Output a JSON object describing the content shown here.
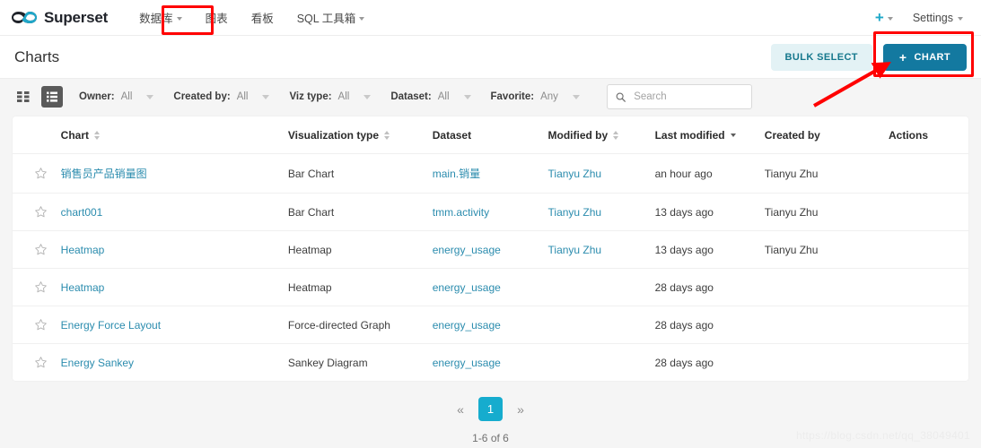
{
  "navbar": {
    "brand": "Superset",
    "items": [
      {
        "label": "数据库",
        "has_caret": true
      },
      {
        "label": "图表",
        "has_caret": false
      },
      {
        "label": "看板",
        "has_caret": false
      },
      {
        "label": "SQL 工具箱",
        "has_caret": true
      }
    ],
    "plus_label": "+",
    "settings_label": "Settings"
  },
  "header": {
    "title": "Charts",
    "bulk_select_label": "BULK SELECT",
    "new_chart_label": "CHART",
    "new_chart_plus": "+"
  },
  "filters": {
    "card_view_icon": "grid-icon",
    "list_view_icon": "list-icon",
    "items": [
      {
        "label": "Owner:",
        "value": "All"
      },
      {
        "label": "Created by:",
        "value": "All"
      },
      {
        "label": "Viz type:",
        "value": "All"
      },
      {
        "label": "Dataset:",
        "value": "All"
      },
      {
        "label": "Favorite:",
        "value": "Any"
      }
    ],
    "search_placeholder": "Search",
    "search_value": ""
  },
  "table": {
    "columns": [
      {
        "key": "star",
        "label": "",
        "sortable": false
      },
      {
        "key": "chart",
        "label": "Chart",
        "sortable": true,
        "sorted": false
      },
      {
        "key": "viz",
        "label": "Visualization type",
        "sortable": true,
        "sorted": false
      },
      {
        "key": "dataset",
        "label": "Dataset",
        "sortable": false
      },
      {
        "key": "modified_by",
        "label": "Modified by",
        "sortable": true,
        "sorted": false
      },
      {
        "key": "last_modified",
        "label": "Last modified",
        "sortable": true,
        "sorted": "desc"
      },
      {
        "key": "created_by",
        "label": "Created by",
        "sortable": false
      },
      {
        "key": "actions",
        "label": "Actions",
        "sortable": false
      }
    ],
    "rows": [
      {
        "favorite": false,
        "chart": "销售员产品销量图",
        "viz": "Bar Chart",
        "dataset": "main.销量",
        "modified_by": "Tianyu Zhu",
        "last_modified": "an hour ago",
        "created_by": "Tianyu Zhu"
      },
      {
        "favorite": false,
        "chart": "chart001",
        "viz": "Bar Chart",
        "dataset": "tmm.activity",
        "modified_by": "Tianyu Zhu",
        "last_modified": "13 days ago",
        "created_by": "Tianyu Zhu"
      },
      {
        "favorite": false,
        "chart": "Heatmap",
        "viz": "Heatmap",
        "dataset": "energy_usage",
        "modified_by": "Tianyu Zhu",
        "last_modified": "13 days ago",
        "created_by": "Tianyu Zhu"
      },
      {
        "favorite": false,
        "chart": "Heatmap",
        "viz": "Heatmap",
        "dataset": "energy_usage",
        "modified_by": "",
        "last_modified": "28 days ago",
        "created_by": ""
      },
      {
        "favorite": false,
        "chart": "Energy Force Layout",
        "viz": "Force-directed Graph",
        "dataset": "energy_usage",
        "modified_by": "",
        "last_modified": "28 days ago",
        "created_by": ""
      },
      {
        "favorite": false,
        "chart": "Energy Sankey",
        "viz": "Sankey Diagram",
        "dataset": "energy_usage",
        "modified_by": "",
        "last_modified": "28 days ago",
        "created_by": ""
      }
    ]
  },
  "pagination": {
    "prev_label": "«",
    "next_label": "»",
    "current_page": "1",
    "range_text": "1-6 of 6"
  },
  "watermark": "https://blog.csdn.net/qq_38049401",
  "colors": {
    "primary": "#1379A0",
    "ghost_bg": "#E3F2F5",
    "link": "#2B8CAE",
    "accent_cyan": "#16ACCE",
    "annotation_red": "#FF0000"
  }
}
